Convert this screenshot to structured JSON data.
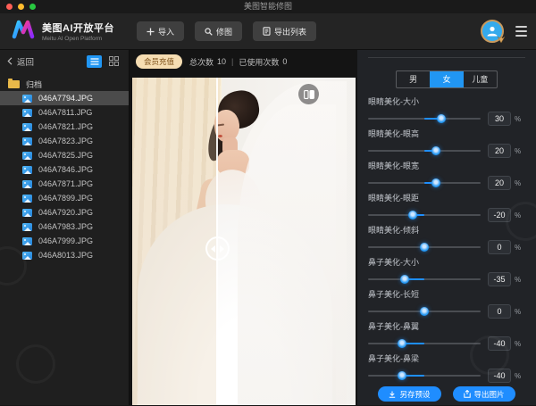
{
  "window": {
    "title": "美图智能修图"
  },
  "titlebar": {
    "traffic_lights": [
      "#ff5f57",
      "#febc2e",
      "#28c840"
    ]
  },
  "toolbar": {
    "brand": {
      "title": "美图AI开放平台",
      "subtitle": "Meitu AI Open Platform",
      "logo": "meitu-m-logo"
    },
    "import_label": "导入",
    "retouch_label": "修图",
    "export_list_label": "导出列表"
  },
  "sidebar": {
    "back_label": "返回",
    "view_modes": [
      "list-view-icon",
      "grid-view-icon"
    ],
    "active_view": 0,
    "folder": "归档",
    "selected_index": 0,
    "files": [
      "046A7794.JPG",
      "046A7811.JPG",
      "046A7821.JPG",
      "046A7823.JPG",
      "046A7825.JPG",
      "046A7846.JPG",
      "046A7871.JPG",
      "046A7899.JPG",
      "046A7920.JPG",
      "046A7983.JPG",
      "046A7999.JPG",
      "046A8013.JPG"
    ]
  },
  "statusbar": {
    "recharge_label": "会员充值",
    "total_label": "总次数",
    "total_value": "10",
    "separator": "|",
    "used_label": "已使用次数",
    "used_value": "0"
  },
  "viewer": {
    "compare_icon": "before-after-compare-icon",
    "split_handle": "before-after-drag-handle"
  },
  "editor": {
    "tabs": [
      {
        "label": "男",
        "active": false
      },
      {
        "label": "女",
        "active": true
      },
      {
        "label": "儿童",
        "active": false
      }
    ],
    "unit": "%",
    "sliders": [
      {
        "label": "眼睛美化-大小",
        "value": 30
      },
      {
        "label": "眼睛美化-眼高",
        "value": 20
      },
      {
        "label": "眼睛美化-眼宽",
        "value": 20
      },
      {
        "label": "眼睛美化-眼距",
        "value": -20
      },
      {
        "label": "眼睛美化-倾斜",
        "value": 0
      },
      {
        "label": "鼻子美化-大小",
        "value": -35
      },
      {
        "label": "鼻子美化-长短",
        "value": 0
      },
      {
        "label": "鼻子美化-鼻翼",
        "value": -40
      },
      {
        "label": "鼻子美化-鼻梁",
        "value": -40
      }
    ],
    "save_preset_label": "另存预设",
    "export_image_label": "导出图片"
  },
  "colors": {
    "accent_blue": "#2196f3",
    "slider_fill": "#1e8fff",
    "recharge_pill_bg": "#f6ddb2",
    "recharge_pill_text": "#7c4f17",
    "selected_row_bg": "#4b4b4b",
    "panel_bg": "#212327",
    "folder_yellow": "#e9b949"
  }
}
